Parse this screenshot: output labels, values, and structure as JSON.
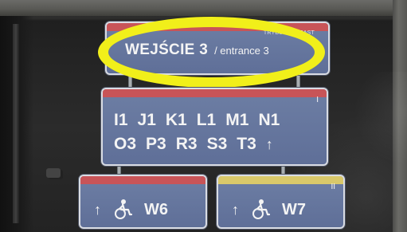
{
  "scene": {
    "main_sign": {
      "top_label": "TRYBUNA I / EAST",
      "title": "WEJŚCIE 3",
      "subtitle": "/ entrance 3"
    },
    "codes_sign": {
      "row_top": [
        "I1",
        "J1",
        "K1",
        "L1",
        "M1",
        "N1"
      ],
      "row_bottom": [
        "O3",
        "P3",
        "R3",
        "S3",
        "T3"
      ],
      "arrow": "↑",
      "roman": "I"
    },
    "w6_sign": {
      "arrow": "↑",
      "code": "W6",
      "strip_color": "#c85458"
    },
    "w7_sign": {
      "arrow": "↑",
      "code": "W7",
      "roman": "II",
      "strip_color": "#d9c86a"
    },
    "colors": {
      "sign_blue": "#667aa1",
      "highlight_yellow": "#f1ef1a",
      "strip_red": "#c85458",
      "strip_yellow": "#d9c86a"
    },
    "icons": [
      "wheelchair-icon",
      "up-arrow-icon",
      "ellipse-highlight"
    ]
  }
}
